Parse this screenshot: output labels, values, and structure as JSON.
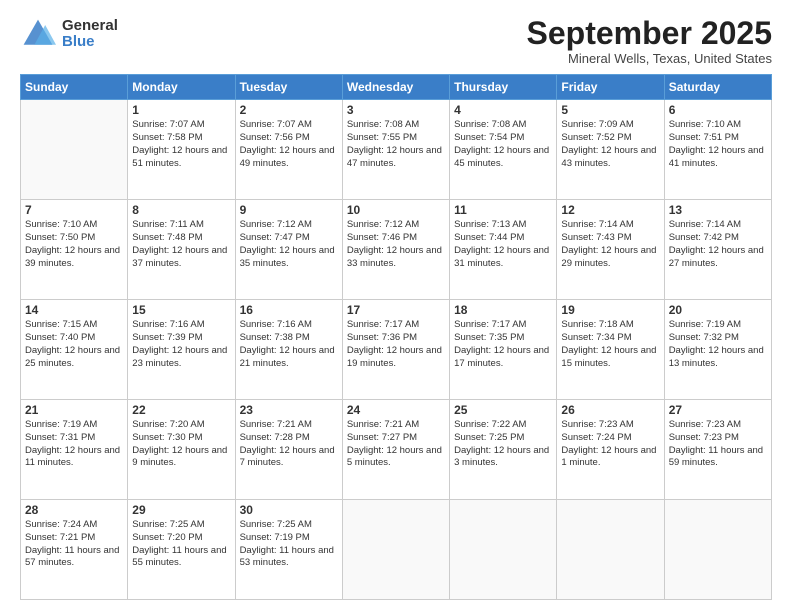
{
  "logo": {
    "general": "General",
    "blue": "Blue"
  },
  "header": {
    "month": "September 2025",
    "location": "Mineral Wells, Texas, United States"
  },
  "weekdays": [
    "Sunday",
    "Monday",
    "Tuesday",
    "Wednesday",
    "Thursday",
    "Friday",
    "Saturday"
  ],
  "weeks": [
    [
      {
        "day": "",
        "sunrise": "",
        "sunset": "",
        "daylight": ""
      },
      {
        "day": "1",
        "sunrise": "Sunrise: 7:07 AM",
        "sunset": "Sunset: 7:58 PM",
        "daylight": "Daylight: 12 hours and 51 minutes."
      },
      {
        "day": "2",
        "sunrise": "Sunrise: 7:07 AM",
        "sunset": "Sunset: 7:56 PM",
        "daylight": "Daylight: 12 hours and 49 minutes."
      },
      {
        "day": "3",
        "sunrise": "Sunrise: 7:08 AM",
        "sunset": "Sunset: 7:55 PM",
        "daylight": "Daylight: 12 hours and 47 minutes."
      },
      {
        "day": "4",
        "sunrise": "Sunrise: 7:08 AM",
        "sunset": "Sunset: 7:54 PM",
        "daylight": "Daylight: 12 hours and 45 minutes."
      },
      {
        "day": "5",
        "sunrise": "Sunrise: 7:09 AM",
        "sunset": "Sunset: 7:52 PM",
        "daylight": "Daylight: 12 hours and 43 minutes."
      },
      {
        "day": "6",
        "sunrise": "Sunrise: 7:10 AM",
        "sunset": "Sunset: 7:51 PM",
        "daylight": "Daylight: 12 hours and 41 minutes."
      }
    ],
    [
      {
        "day": "7",
        "sunrise": "Sunrise: 7:10 AM",
        "sunset": "Sunset: 7:50 PM",
        "daylight": "Daylight: 12 hours and 39 minutes."
      },
      {
        "day": "8",
        "sunrise": "Sunrise: 7:11 AM",
        "sunset": "Sunset: 7:48 PM",
        "daylight": "Daylight: 12 hours and 37 minutes."
      },
      {
        "day": "9",
        "sunrise": "Sunrise: 7:12 AM",
        "sunset": "Sunset: 7:47 PM",
        "daylight": "Daylight: 12 hours and 35 minutes."
      },
      {
        "day": "10",
        "sunrise": "Sunrise: 7:12 AM",
        "sunset": "Sunset: 7:46 PM",
        "daylight": "Daylight: 12 hours and 33 minutes."
      },
      {
        "day": "11",
        "sunrise": "Sunrise: 7:13 AM",
        "sunset": "Sunset: 7:44 PM",
        "daylight": "Daylight: 12 hours and 31 minutes."
      },
      {
        "day": "12",
        "sunrise": "Sunrise: 7:14 AM",
        "sunset": "Sunset: 7:43 PM",
        "daylight": "Daylight: 12 hours and 29 minutes."
      },
      {
        "day": "13",
        "sunrise": "Sunrise: 7:14 AM",
        "sunset": "Sunset: 7:42 PM",
        "daylight": "Daylight: 12 hours and 27 minutes."
      }
    ],
    [
      {
        "day": "14",
        "sunrise": "Sunrise: 7:15 AM",
        "sunset": "Sunset: 7:40 PM",
        "daylight": "Daylight: 12 hours and 25 minutes."
      },
      {
        "day": "15",
        "sunrise": "Sunrise: 7:16 AM",
        "sunset": "Sunset: 7:39 PM",
        "daylight": "Daylight: 12 hours and 23 minutes."
      },
      {
        "day": "16",
        "sunrise": "Sunrise: 7:16 AM",
        "sunset": "Sunset: 7:38 PM",
        "daylight": "Daylight: 12 hours and 21 minutes."
      },
      {
        "day": "17",
        "sunrise": "Sunrise: 7:17 AM",
        "sunset": "Sunset: 7:36 PM",
        "daylight": "Daylight: 12 hours and 19 minutes."
      },
      {
        "day": "18",
        "sunrise": "Sunrise: 7:17 AM",
        "sunset": "Sunset: 7:35 PM",
        "daylight": "Daylight: 12 hours and 17 minutes."
      },
      {
        "day": "19",
        "sunrise": "Sunrise: 7:18 AM",
        "sunset": "Sunset: 7:34 PM",
        "daylight": "Daylight: 12 hours and 15 minutes."
      },
      {
        "day": "20",
        "sunrise": "Sunrise: 7:19 AM",
        "sunset": "Sunset: 7:32 PM",
        "daylight": "Daylight: 12 hours and 13 minutes."
      }
    ],
    [
      {
        "day": "21",
        "sunrise": "Sunrise: 7:19 AM",
        "sunset": "Sunset: 7:31 PM",
        "daylight": "Daylight: 12 hours and 11 minutes."
      },
      {
        "day": "22",
        "sunrise": "Sunrise: 7:20 AM",
        "sunset": "Sunset: 7:30 PM",
        "daylight": "Daylight: 12 hours and 9 minutes."
      },
      {
        "day": "23",
        "sunrise": "Sunrise: 7:21 AM",
        "sunset": "Sunset: 7:28 PM",
        "daylight": "Daylight: 12 hours and 7 minutes."
      },
      {
        "day": "24",
        "sunrise": "Sunrise: 7:21 AM",
        "sunset": "Sunset: 7:27 PM",
        "daylight": "Daylight: 12 hours and 5 minutes."
      },
      {
        "day": "25",
        "sunrise": "Sunrise: 7:22 AM",
        "sunset": "Sunset: 7:25 PM",
        "daylight": "Daylight: 12 hours and 3 minutes."
      },
      {
        "day": "26",
        "sunrise": "Sunrise: 7:23 AM",
        "sunset": "Sunset: 7:24 PM",
        "daylight": "Daylight: 12 hours and 1 minute."
      },
      {
        "day": "27",
        "sunrise": "Sunrise: 7:23 AM",
        "sunset": "Sunset: 7:23 PM",
        "daylight": "Daylight: 11 hours and 59 minutes."
      }
    ],
    [
      {
        "day": "28",
        "sunrise": "Sunrise: 7:24 AM",
        "sunset": "Sunset: 7:21 PM",
        "daylight": "Daylight: 11 hours and 57 minutes."
      },
      {
        "day": "29",
        "sunrise": "Sunrise: 7:25 AM",
        "sunset": "Sunset: 7:20 PM",
        "daylight": "Daylight: 11 hours and 55 minutes."
      },
      {
        "day": "30",
        "sunrise": "Sunrise: 7:25 AM",
        "sunset": "Sunset: 7:19 PM",
        "daylight": "Daylight: 11 hours and 53 minutes."
      },
      {
        "day": "",
        "sunrise": "",
        "sunset": "",
        "daylight": ""
      },
      {
        "day": "",
        "sunrise": "",
        "sunset": "",
        "daylight": ""
      },
      {
        "day": "",
        "sunrise": "",
        "sunset": "",
        "daylight": ""
      },
      {
        "day": "",
        "sunrise": "",
        "sunset": "",
        "daylight": ""
      }
    ]
  ]
}
